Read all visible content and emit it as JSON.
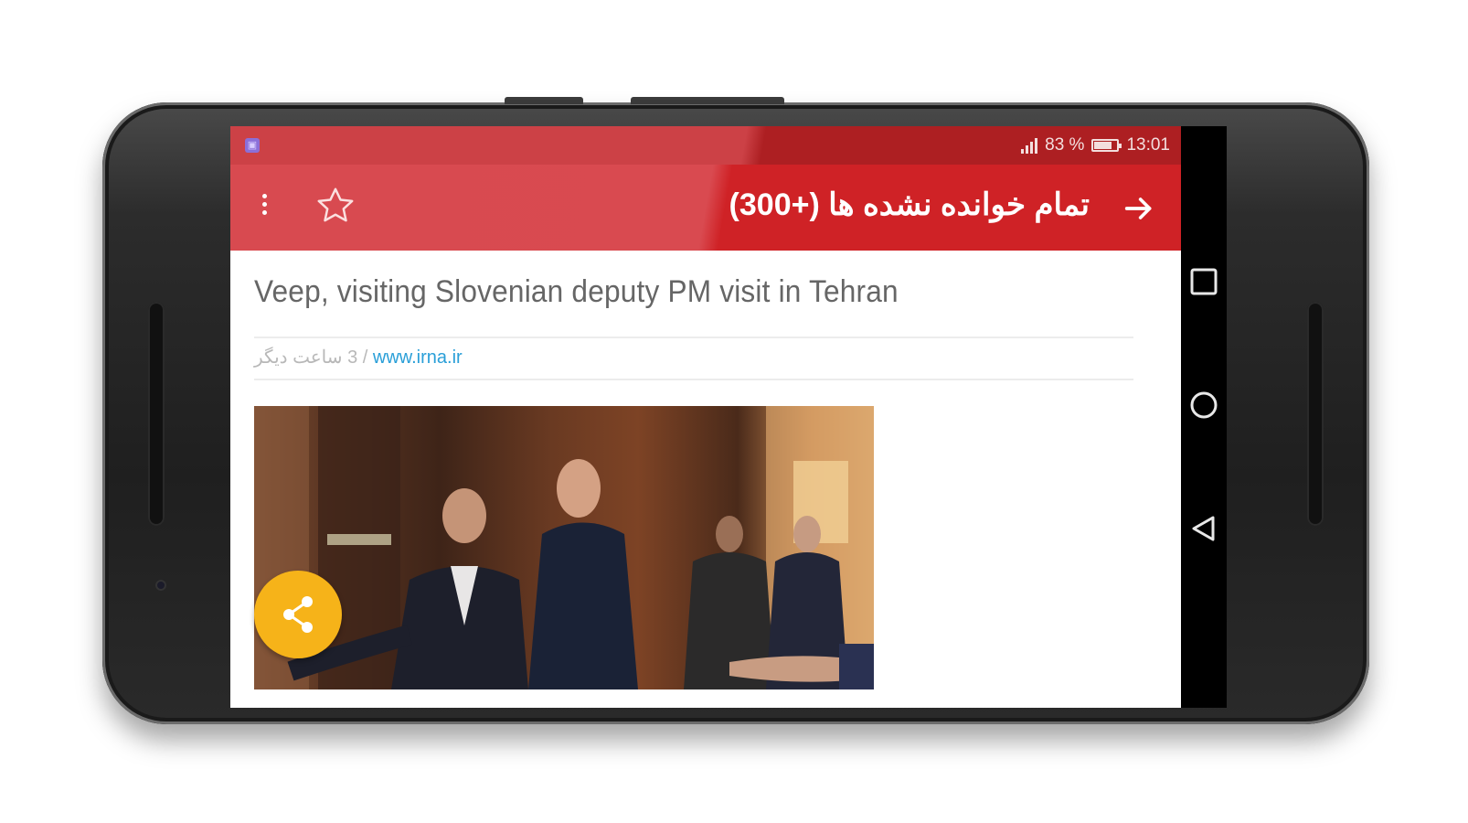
{
  "status_bar": {
    "signal_icon": "signal-icon",
    "battery_label": "83 %",
    "battery_level": 0.83,
    "battery_icon": "battery-icon",
    "time": "13:01",
    "notification_icon": "app-notification-icon"
  },
  "toolbar": {
    "title": "تمام خوانده نشده ها (+300)",
    "back_icon": "arrow-right-icon",
    "star_icon": "star-outline-icon",
    "menu_icon": "more-vert-icon"
  },
  "article": {
    "title": "Veep, visiting Slovenian deputy PM visit in Tehran",
    "time_ago": "3 ساعت دیگر",
    "separator": " / ",
    "source": "www.irna.ir"
  },
  "share_button": {
    "icon": "share-icon"
  },
  "nav_bar": {
    "recents_icon": "square-icon",
    "home_icon": "circle-icon",
    "back_icon": "triangle-back-icon"
  },
  "colors": {
    "toolbar_red": "#cf2226",
    "status_red": "#ad1f22",
    "fab_yellow": "#f6b319",
    "link_blue": "#2a9fd8"
  }
}
